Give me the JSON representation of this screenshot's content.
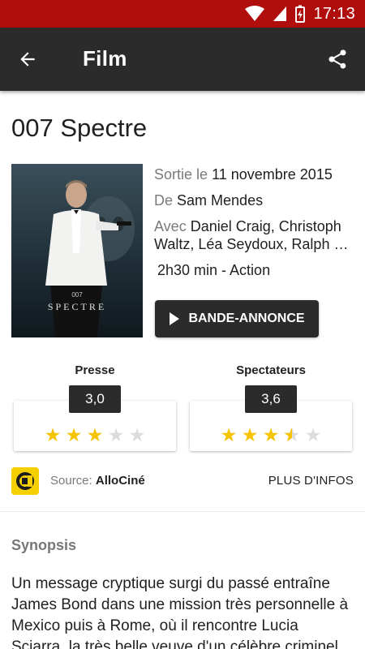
{
  "status_bar": {
    "time": "17:13",
    "background": "#b00d0d"
  },
  "toolbar": {
    "title": "Film",
    "background": "#2b2b2b",
    "back_icon": "arrow-left-icon",
    "share_icon": "share-icon"
  },
  "movie": {
    "title": "007 Spectre",
    "poster": {
      "title_line1": "007",
      "title_line2": "SPECTRE"
    },
    "release_label": "Sortie le",
    "release_date": "11 novembre 2015",
    "director_label": "De",
    "director": "Sam Mendes",
    "cast_label": "Avec",
    "cast": "Daniel Craig, Christoph Waltz, Léa Seydoux, Ralph …",
    "duration_genre": "2h30 min - Action",
    "trailer_label": "BANDE-ANNONCE"
  },
  "ratings": [
    {
      "label": "Presse",
      "score": "3,0",
      "value": 3.0,
      "max": 5
    },
    {
      "label": "Spectateurs",
      "score": "3,6",
      "value": 3.6,
      "max": 5
    }
  ],
  "source": {
    "prefix": "Source:",
    "name": "AlloCiné",
    "more_label": "PLUS D'INFOS",
    "logo_color": "#f5d000"
  },
  "synopsis": {
    "title": "Synopsis",
    "text": "Un message cryptique surgi du passé entraîne James Bond dans une mission très personnelle à Mexico puis à Rome, où il rencontre Lucia Sciarra, la très belle veuve d'un célèbre criminel."
  },
  "colors": {
    "star_filled": "#f5c300",
    "star_empty": "#dcdcdc",
    "dark": "#2b2b2b"
  }
}
